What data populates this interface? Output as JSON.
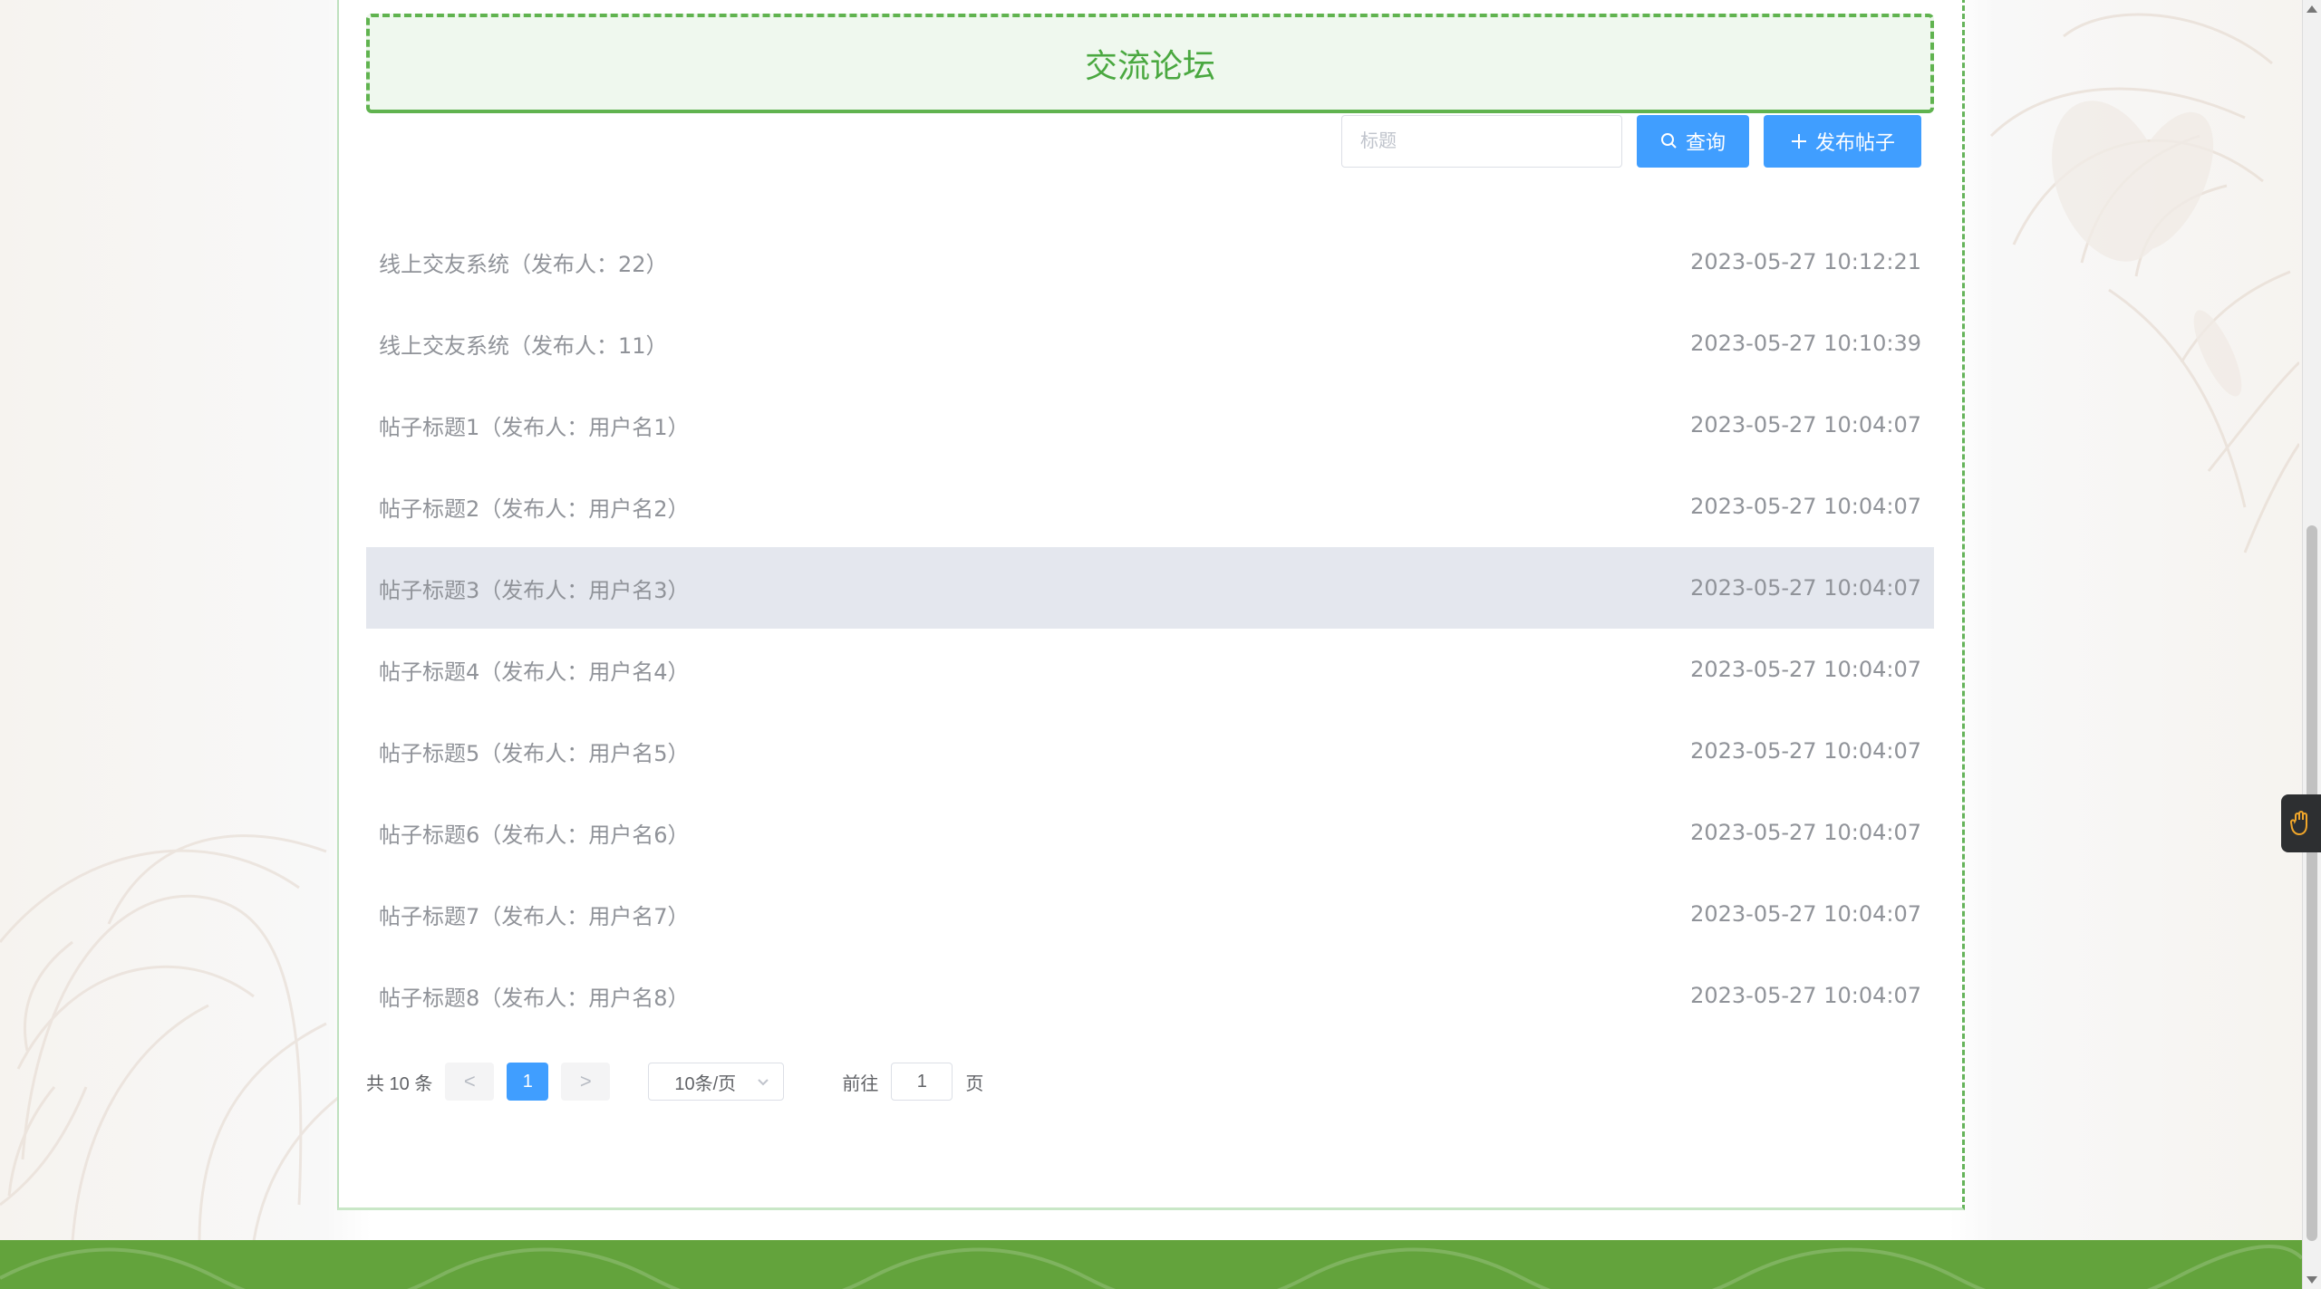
{
  "forum": {
    "title": "交流论坛"
  },
  "search": {
    "placeholder": "标题",
    "query_label": "查询",
    "publish_label": "发布帖子"
  },
  "posts": [
    {
      "title": "线上交友系统（发布人：22）",
      "time": "2023-05-27 10:12:21"
    },
    {
      "title": "线上交友系统（发布人：11）",
      "time": "2023-05-27 10:10:39"
    },
    {
      "title": "帖子标题1（发布人：用户名1）",
      "time": "2023-05-27 10:04:07"
    },
    {
      "title": "帖子标题2（发布人：用户名2）",
      "time": "2023-05-27 10:04:07"
    },
    {
      "title": "帖子标题3（发布人：用户名3）",
      "time": "2023-05-27 10:04:07"
    },
    {
      "title": "帖子标题4（发布人：用户名4）",
      "time": "2023-05-27 10:04:07"
    },
    {
      "title": "帖子标题5（发布人：用户名5）",
      "time": "2023-05-27 10:04:07"
    },
    {
      "title": "帖子标题6（发布人：用户名6）",
      "time": "2023-05-27 10:04:07"
    },
    {
      "title": "帖子标题7（发布人：用户名7）",
      "time": "2023-05-27 10:04:07"
    },
    {
      "title": "帖子标题8（发布人：用户名8）",
      "time": "2023-05-27 10:04:07"
    }
  ],
  "pagination": {
    "total_text": "共 10 条",
    "prev": "<",
    "current_page": "1",
    "next": ">",
    "page_size": "10条/页",
    "jump_prefix": "前往",
    "jump_value": "1",
    "jump_suffix": "页"
  },
  "icons": {
    "search": "search-icon",
    "plus": "plus-icon",
    "dropdown": "chevron-down-icon",
    "hand": "hand-icon"
  },
  "colors": {
    "accent": "#409eff",
    "title_green": "#4aa840",
    "border_green": "#60b34f",
    "title_background": "#eff8ee",
    "row_highlight": "#e4e7ee",
    "footer_green": "#63a33c"
  }
}
